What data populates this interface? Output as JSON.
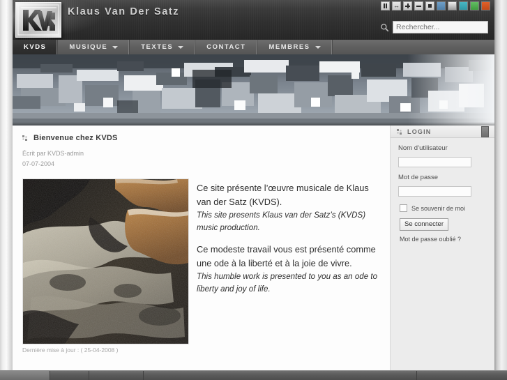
{
  "window": {
    "controls": [
      {
        "name": "pause-window-icon",
        "glyph": "pause"
      },
      {
        "name": "resize-horizontal-icon",
        "glyph": "hresize"
      },
      {
        "name": "maximize-icon",
        "glyph": "plus"
      },
      {
        "name": "minimize-icon",
        "glyph": "minus"
      },
      {
        "name": "restore-icon",
        "glyph": "square"
      }
    ],
    "color_swatches": [
      {
        "name": "workspace-blue-icon",
        "color": "#5f8fb8"
      },
      {
        "name": "workspace-gray-icon",
        "color": "#b4b4b4"
      },
      {
        "name": "workspace-teal-icon",
        "color": "#3ba7b5"
      },
      {
        "name": "workspace-green-icon",
        "color": "#51ac51"
      },
      {
        "name": "workspace-orange-icon",
        "color": "#d15521"
      }
    ]
  },
  "header": {
    "site_title": "Klaus Van Der Satz",
    "logo_alt": "KVDS"
  },
  "search": {
    "placeholder": "Rechercher...",
    "value": ""
  },
  "nav": {
    "items": [
      {
        "label": "KVDS",
        "active": true,
        "has_dropdown": false
      },
      {
        "label": "MUSIQUE",
        "active": false,
        "has_dropdown": true
      },
      {
        "label": "TEXTES",
        "active": false,
        "has_dropdown": true
      },
      {
        "label": "CONTACT",
        "active": false,
        "has_dropdown": false
      },
      {
        "label": "MEMBRES",
        "active": false,
        "has_dropdown": true
      }
    ]
  },
  "banner": {
    "alt": "Abstract grayscale 3D cityscape of stacked cubes"
  },
  "article": {
    "title": "Bienvenue chez KVDS",
    "author_line": "Écrit par KVDS-admin",
    "date": "07-07-2004",
    "image_alt": "Close-up texture of tree bark with bracket fungus",
    "paragraphs": [
      {
        "lang": "fr",
        "text": "Ce site présente l’œuvre musicale de Klaus van der Satz (KVDS)."
      },
      {
        "lang": "en",
        "text": "This site presents Klaus van der Satz’s (KVDS) music production."
      },
      {
        "lang": "fr",
        "text": "Ce modeste travail vous est présenté comme une ode à la liberté et à la joie de vivre."
      },
      {
        "lang": "en",
        "text": "This humble work is presented to you as an ode to liberty and joy of life."
      }
    ],
    "footer": "Dernière mise à jour : ( 25-04-2008 )"
  },
  "login": {
    "module_title": "LOGIN",
    "username_label": "Nom d’utilisateur",
    "username_value": "",
    "password_label": "Mot de passe",
    "password_value": "",
    "remember_label": "Se souvenir de moi",
    "submit_label": "Se connecter",
    "forgot_label": "Mot de passe oublié ?"
  },
  "colors": {
    "nav_bar": "#5f5f5f",
    "nav_active": "#303030",
    "header_dark": "#2f2f2f",
    "sidebar_bg": "#ececec",
    "content_bg": "#fdfdfd"
  }
}
